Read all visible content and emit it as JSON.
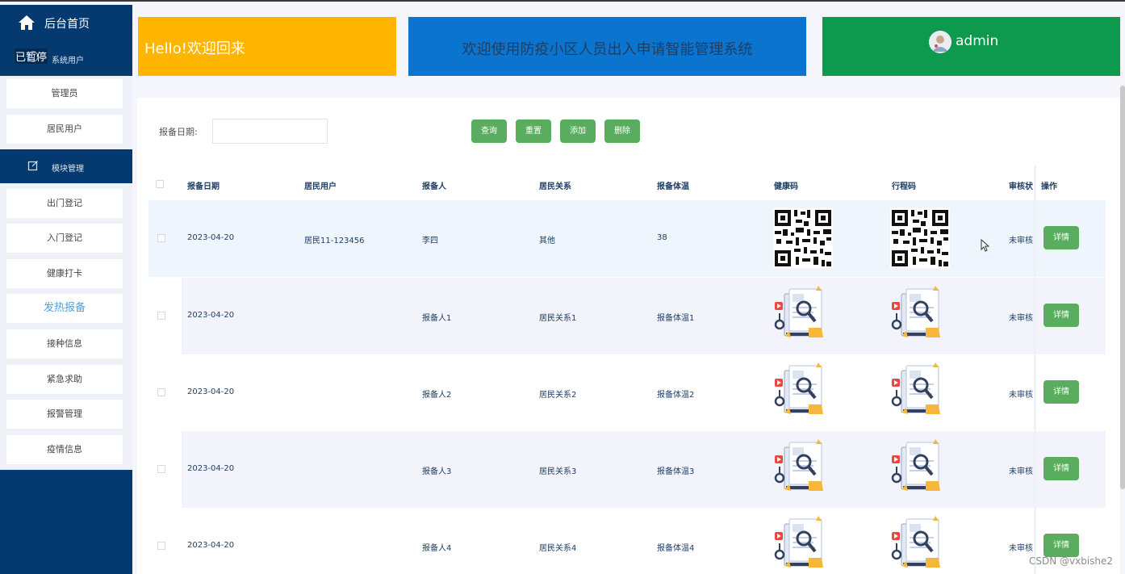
{
  "paused_overlay": "已暂停",
  "sidebar": {
    "home_label": "后台首页",
    "system_users_label": "系统用户",
    "system_users_items": [
      {
        "label": "管理员"
      },
      {
        "label": "居民用户"
      }
    ],
    "module_label": "模块管理",
    "module_items": [
      {
        "label": "出门登记"
      },
      {
        "label": "入门登记"
      },
      {
        "label": "健康打卡"
      },
      {
        "label": "发热报备"
      },
      {
        "label": "接种信息"
      },
      {
        "label": "紧急求助"
      },
      {
        "label": "报警管理"
      },
      {
        "label": "疫情信息"
      }
    ],
    "active_item": "发热报备"
  },
  "header": {
    "hello_text": "Hello!欢迎回来",
    "system_title": "欢迎使用防疫小区人员出入申请智能管理系统",
    "admin_name": "admin",
    "colors": {
      "hello": "#ffb400",
      "title": "#0b74cf",
      "admin": "#0d9a4f"
    }
  },
  "search": {
    "date_label": "报备日期:",
    "date_value": "",
    "buttons": {
      "query": "查询",
      "reset": "重置",
      "add": "添加",
      "delete": "删除"
    }
  },
  "table": {
    "headers": [
      "报备日期",
      "居民用户",
      "报备人",
      "居民关系",
      "报备体温",
      "健康码",
      "行程码",
      "审核状",
      "操作"
    ],
    "rows": [
      {
        "date": "2023-04-20",
        "resident": "居民11-123456",
        "reporter": "李四",
        "relation": "其他",
        "temperature": "38",
        "health_code": "qr-code-image",
        "trip_code": "qr-code-image",
        "status": "未审核",
        "action": "详情"
      },
      {
        "date": "2023-04-20",
        "resident": "",
        "reporter": "报备人1",
        "relation": "居民关系1",
        "temperature": "报备体温1",
        "health_code": "document-illustration",
        "trip_code": "document-illustration",
        "status": "未审核",
        "action": "详情"
      },
      {
        "date": "2023-04-20",
        "resident": "",
        "reporter": "报备人2",
        "relation": "居民关系2",
        "temperature": "报备体温2",
        "health_code": "document-illustration",
        "trip_code": "document-illustration",
        "status": "未审核",
        "action": "详情"
      },
      {
        "date": "2023-04-20",
        "resident": "",
        "reporter": "报备人3",
        "relation": "居民关系3",
        "temperature": "报备体温3",
        "health_code": "document-illustration",
        "trip_code": "document-illustration",
        "status": "未审核",
        "action": "详情"
      },
      {
        "date": "2023-04-20",
        "resident": "",
        "reporter": "报备人4",
        "relation": "居民关系4",
        "temperature": "报备体温4",
        "health_code": "document-illustration",
        "trip_code": "document-illustration",
        "status": "未审核",
        "action": "详情"
      }
    ]
  },
  "watermark": "CSDN @vxbishe2",
  "button_color": "#5aad5e"
}
